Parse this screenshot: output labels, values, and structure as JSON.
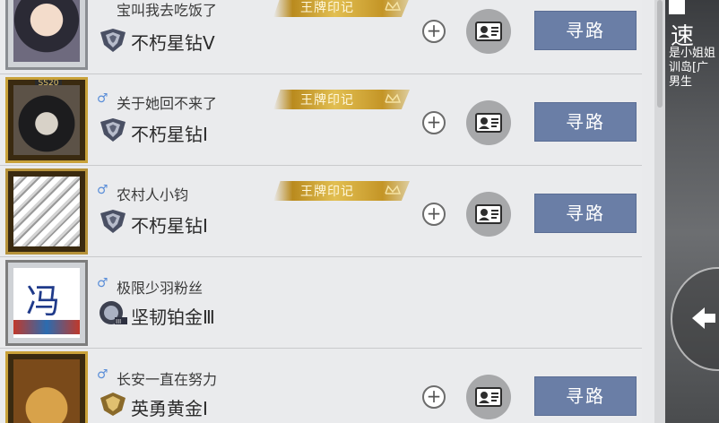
{
  "players": [
    {
      "name": "宝叫我去吃饭了",
      "gender_icon": "male-icon",
      "rank": "不朽星钻Ⅴ",
      "rank_icon": "immortal-diamond-icon",
      "ace_badge": "王牌印记",
      "avatar_frame_tag": "",
      "route_label": "寻路",
      "add_friend": "+",
      "show_gender": false
    },
    {
      "name": "关于她回不来了",
      "gender_icon": "male-icon",
      "rank": "不朽星钻Ⅰ",
      "rank_icon": "immortal-diamond-icon",
      "ace_badge": "王牌印记",
      "avatar_frame_tag": "SS20",
      "route_label": "寻路",
      "add_friend": "+",
      "show_gender": true
    },
    {
      "name": "农村人小钧",
      "gender_icon": "male-icon",
      "rank": "不朽星钻Ⅰ",
      "rank_icon": "immortal-diamond-icon",
      "ace_badge": "王牌印记",
      "avatar_frame_tag": "",
      "route_label": "寻路",
      "add_friend": "+",
      "show_gender": true
    },
    {
      "name": "极限少羽粉丝",
      "gender_icon": "male-icon",
      "rank": "坚韧铂金Ⅲ",
      "rank_icon": "tough-platinum-icon",
      "ace_badge": "",
      "avatar_frame_tag": "",
      "avatar_glyph": "冯",
      "route_label": "",
      "add_friend": "",
      "show_gender": true
    },
    {
      "name": "长安一直在努力",
      "gender_icon": "male-icon",
      "rank": "英勇黄金Ⅰ",
      "rank_icon": "brave-gold-icon",
      "ace_badge": "",
      "avatar_frame_tag": "",
      "route_label": "寻路",
      "add_friend": "+",
      "show_gender": true
    }
  ],
  "game_view": {
    "speed_label": "速",
    "chat_lines": [
      "是小姐姐",
      "训岛[广",
      "男生"
    ]
  },
  "colors": {
    "route_button": "#6a7ea6",
    "ace_badge_gold": "#d4ac3a",
    "gender_male": "#5a8ed8",
    "list_background": "#eaebed"
  }
}
